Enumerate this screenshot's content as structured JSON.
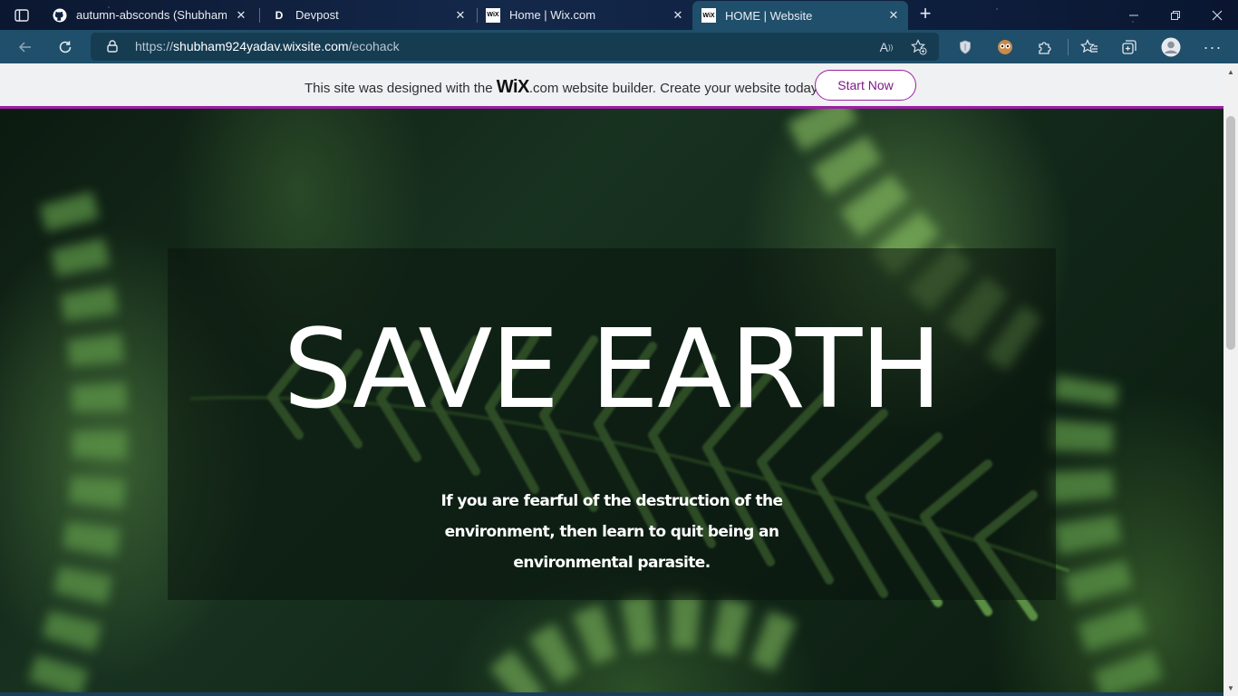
{
  "browser": {
    "tabs": [
      {
        "title": "autumn-absconds (Shubham Ya",
        "icon": "github-icon",
        "active": false
      },
      {
        "title": "Devpost",
        "icon": "devpost-icon",
        "active": false
      },
      {
        "title": "Home | Wix.com",
        "icon": "wix-icon",
        "active": false
      },
      {
        "title": "HOME | Website",
        "icon": "wix-icon",
        "active": true
      }
    ],
    "favicon_wix_text": "WiX",
    "favicon_devpost_text": "D",
    "address": {
      "scheme": "https://",
      "host": "shubham924yadav.wixsite.com",
      "path": "/ecohack"
    },
    "colors": {
      "accent": "#1f4f6a",
      "tabbar": "#0e2040"
    }
  },
  "wix_banner": {
    "text_before": "This site was designed with the ",
    "logo": "WiX",
    "logo_suffix": ".com",
    "text_after": " website builder. Create your website today.",
    "button": "Start Now",
    "accent": "#9c1ea5"
  },
  "hero": {
    "title": "SAVE EARTH",
    "subtitle": "If you are fearful of the destruction of the environment, then learn to quit being an environmental parasite."
  }
}
